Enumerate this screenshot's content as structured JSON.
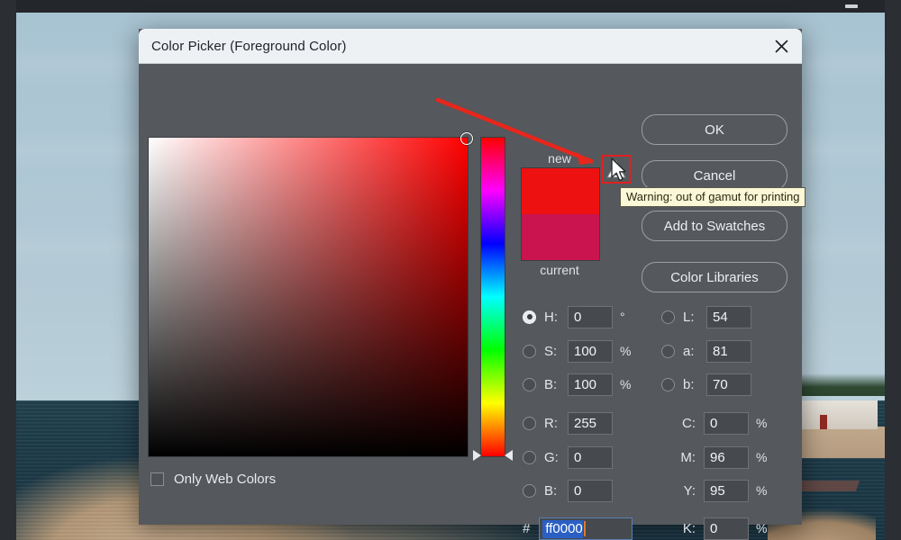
{
  "window": {
    "minimize_icon": "minimize-icon"
  },
  "dialog": {
    "title": "Color Picker (Foreground Color)",
    "close_icon": "close-icon"
  },
  "picker": {
    "field_hue_color": "#ff0000",
    "marker_icon": "field-marker-icon",
    "hue_slider": {
      "stops": [
        "#ff0000",
        "#ff00ff",
        "#0000ff",
        "#00ffff",
        "#00ff00",
        "#ffff00",
        "#ff0000"
      ],
      "arrow_left_icon": "hue-arrow-left-icon",
      "arrow_right_icon": "hue-arrow-right-icon"
    }
  },
  "swatches": {
    "new_label": "new",
    "current_label": "current",
    "new_color": "#ee1111",
    "current_color": "#c9144f"
  },
  "gamut": {
    "icon": "warning-triangle-icon",
    "tooltip": "Warning: out of gamut for printing",
    "highlight_color": "#e02020"
  },
  "annotation": {
    "arrow_icon": "red-arrow-annotation",
    "color": "#e8261c"
  },
  "cursor": {
    "icon": "mouse-pointer-icon"
  },
  "buttons": {
    "ok": "OK",
    "cancel": "Cancel",
    "add_to_swatches": "Add to Swatches",
    "color_libraries": "Color Libraries"
  },
  "fields": {
    "hsb": [
      {
        "name": "hue",
        "label": "H:",
        "value": "0",
        "unit": "°",
        "selected": true
      },
      {
        "name": "saturation",
        "label": "S:",
        "value": "100",
        "unit": "%",
        "selected": false
      },
      {
        "name": "brightness",
        "label": "B:",
        "value": "100",
        "unit": "%",
        "selected": false
      }
    ],
    "lab": [
      {
        "name": "lightness",
        "label": "L:",
        "value": "54",
        "unit": "",
        "selected": false
      },
      {
        "name": "a",
        "label": "a:",
        "value": "81",
        "unit": "",
        "selected": false
      },
      {
        "name": "b",
        "label": "b:",
        "value": "70",
        "unit": "",
        "selected": false
      }
    ],
    "rgb": [
      {
        "name": "red",
        "label": "R:",
        "value": "255",
        "unit": "",
        "selected": false
      },
      {
        "name": "green",
        "label": "G:",
        "value": "0",
        "unit": "",
        "selected": false
      },
      {
        "name": "blue",
        "label": "B:",
        "value": "0",
        "unit": "",
        "selected": false
      }
    ],
    "cmyk": [
      {
        "name": "cyan",
        "label": "C:",
        "value": "0",
        "unit": "%"
      },
      {
        "name": "magenta",
        "label": "M:",
        "value": "96",
        "unit": "%"
      },
      {
        "name": "yellow",
        "label": "Y:",
        "value": "95",
        "unit": "%"
      },
      {
        "name": "black",
        "label": "K:",
        "value": "0",
        "unit": "%"
      }
    ]
  },
  "hex": {
    "hash": "#",
    "value": "ff0000"
  },
  "web_colors": {
    "label": "Only Web Colors",
    "checked": false
  }
}
